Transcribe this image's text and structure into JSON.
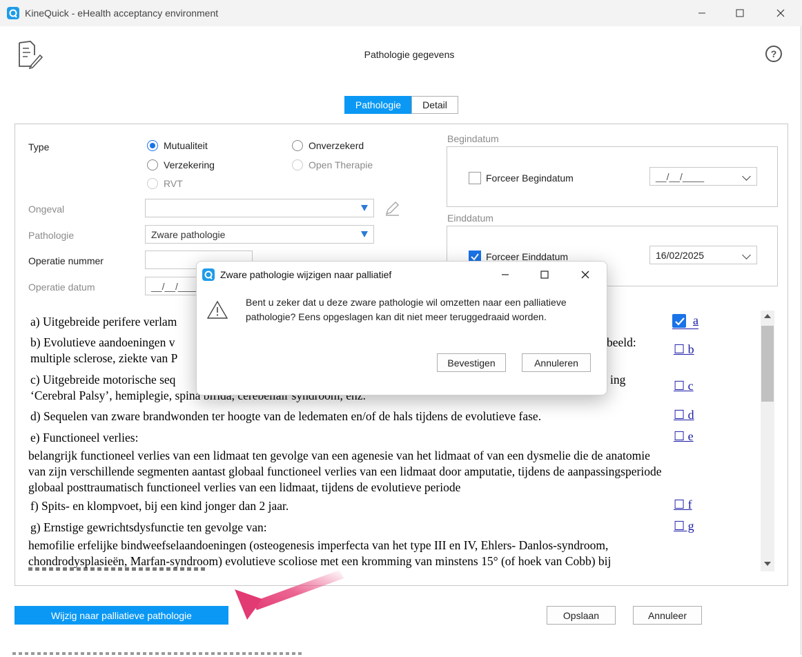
{
  "window": {
    "title": "KineQuick - eHealth acceptancy environment"
  },
  "header": {
    "title": "Pathologie gegevens",
    "help_label": "?"
  },
  "tabs": [
    {
      "label": "Pathologie",
      "active": true
    },
    {
      "label": "Detail",
      "active": false
    }
  ],
  "form": {
    "type_label": "Type",
    "type_options": [
      {
        "label": "Mutualiteit",
        "selected": true,
        "enabled": true
      },
      {
        "label": "Onverzekerd",
        "selected": false,
        "enabled": true
      },
      {
        "label": "Verzekering",
        "selected": false,
        "enabled": true
      },
      {
        "label": "Open Therapie",
        "selected": false,
        "enabled": false
      },
      {
        "label": "RVT",
        "selected": false,
        "enabled": false
      }
    ],
    "ongeval_label": "Ongeval",
    "ongeval_value": "",
    "pathologie_label": "Pathologie",
    "pathologie_value": "Zware pathologie",
    "operatie_nummer_label": "Operatie nummer",
    "operatie_nummer_value": "",
    "operatie_datum_label": "Operatie datum",
    "operatie_datum_value": "__/__/____"
  },
  "begindatum": {
    "group_title": "Begindatum",
    "checkbox_label": "Forceer Begindatum",
    "checked": false,
    "date_value": "__/__/____"
  },
  "einddatum": {
    "group_title": "Einddatum",
    "checkbox_label": "Forceer Einddatum",
    "checked": true,
    "date_value": "16/02/2025"
  },
  "criteria": {
    "a_text": "a) Uitgebreide perifere verlam",
    "a_link": "a",
    "b_text_1": "b) Evolutieve aandoeningen v",
    "b_text_1_end": "beeld:",
    "b_text_2": "multiple sclerose, ziekte van P",
    "b_link": "☐ b",
    "c_text_1": "c) Uitgebreide motorische seq",
    "c_text_1_end": "ing",
    "c_text_2": "‘Cerebral Palsy’, hemiplegie, spina bifida, cerebellair syndroom, enz.",
    "c_link": "☐ c",
    "d_text": "d) Sequelen van zware brandwonden ter hoogte van de ledematen en/of de hals tijdens de evolutieve fase.",
    "d_link": "☐ d",
    "e_text": "e) Functioneel verlies:",
    "e_link": "☐ e",
    "e_detail_1": "belangrijk functioneel verlies van een lidmaat ten gevolge van een agenesie van het lidmaat of van een dysmelie die de anatomie",
    "e_detail_2": "van zijn verschillende segmenten aantast globaal functioneel verlies van een lidmaat door amputatie, tijdens de aanpassingsperiode",
    "e_detail_3": "globaal posttraumatisch functioneel verlies van een lidmaat, tijdens de evolutieve periode",
    "f_text": "f) Spits- en klompvoet, bij een kind jonger dan 2 jaar.",
    "f_link": "☐ f",
    "g_text": "g) Ernstige gewrichtsdysfunctie ten gevolge van:",
    "g_link": "☐ g",
    "g_detail_1": "hemofilie erfelijke bindweefselaandoeningen (osteogenesis imperfecta van het type III en IV, Ehlers- Danlos-syndroom,",
    "g_detail_2": "chondrodysplasieën, Marfan-syndroom) evolutieve scoliose met een kromming van minstens 15° (of hoek van Cobb) bij"
  },
  "footer": {
    "palliatief_button": "Wijzig naar palliatieve pathologie",
    "opslaan_button": "Opslaan",
    "annuleer_button": "Annuleer"
  },
  "dialog": {
    "title": "Zware pathologie wijzigen naar palliatief",
    "message_1": "Bent u zeker dat u deze zware pathologie wil omzetten naar een palliatieve",
    "message_2": "pathologie? Eens opgeslagen kan dit niet meer teruggedraaid worden.",
    "confirm_button": "Bevestigen",
    "cancel_button": "Annuleren"
  },
  "colors": {
    "accent": "#0a98f4",
    "checkbox_blue": "#1a73e8",
    "link_blue": "#1a1aa6",
    "arrow_pink": "#e84a7f"
  }
}
